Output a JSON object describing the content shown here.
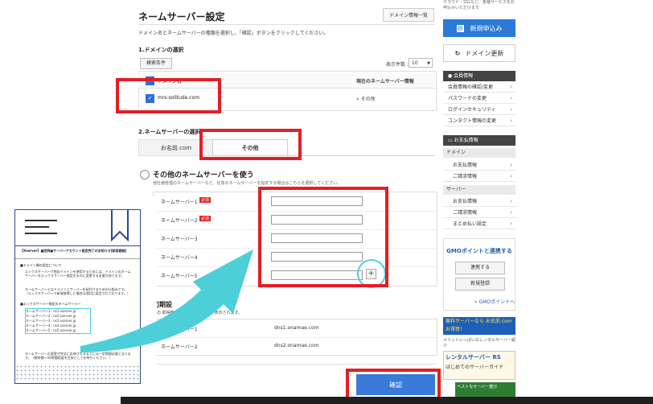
{
  "header": {
    "title": "ネームサーバー設定",
    "domain_list_button": "ドメイン情報一覧",
    "description": "ドメイン名とネームサーバーの種類を選択し、「確認」ボタンをクリックしてください。"
  },
  "step1": {
    "heading": "1.ドメインの選択",
    "search_button": "検索条件",
    "per_page_label": "表示件数 :",
    "per_page_value": "10",
    "col_domain": "ドメイン名",
    "col_ns": "現在のネームサーバー情報",
    "row_domain": "mrs-solitude.com",
    "row_ns": "» その他"
  },
  "step2": {
    "heading": "2.ネームサーバーの選択",
    "tab_onamae": "お名前.com",
    "tab_other": "その他",
    "other_option_title": "その他のネームサーバーを使う",
    "other_option_desc": "他社様管理のネームサーバーなど、任意のネームサーバーを指定する場合はこちらを選択してください。",
    "required_badge": "必須",
    "ns_labels": [
      "ネームサーバー1",
      "ネームサーバー2",
      "ネームサーバー3",
      "ネームサーバー4",
      "ネームサーバー5"
    ],
    "plus_label": "+"
  },
  "initial": {
    "heading": "初期設",
    "desc": "この 取得時の初期設定のページが表示されます。",
    "rows": [
      {
        "label": "ネームサーバー1",
        "value": "dns1.onamae.com"
      },
      {
        "label": "ネームサーバー2",
        "value": "dns2.onamae.com"
      }
    ]
  },
  "confirm_button": "確認",
  "sidebar": {
    "top_note": "クラウド・SSLなど、各種サービスをお申込みいただけます",
    "apply_button": "新規申込み",
    "renew_button": "ドメイン更新",
    "member_head": "会員情報",
    "member_items": [
      "会員情報の確認/変更",
      "パスワードの変更",
      "ログインセキュリティ",
      "コンタクト情報の変更"
    ],
    "payment_head": "お支払情報",
    "domain_sub": "ドメイン",
    "domain_items": [
      "お支払情報",
      "ご請求情報"
    ],
    "server_sub": "サーバー",
    "server_items": [
      "お支払情報",
      "ご請求情報",
      "まとめ払い設定"
    ],
    "gmo_title": "GMOポイントと連携する",
    "gmo_link_button": "連携する",
    "gmo_register_button": "新規登録",
    "gmo_point_link": "» GMOポイントへ",
    "banner1_text": "無料サーバーなら お名前.comお得意！",
    "banner2_caption": "メリットいっぱいのレンタルサーバー紹介",
    "banner3_title": "レンタルサーバー RS",
    "banner3_sub": "はじめてのサーバーガイド",
    "banner4_text": "ベストなサーバー選び"
  },
  "document": {
    "heading": "【Xserver】■定例■サーバーアカウント設定完了のお知らせ[試用期間]",
    "section1": "■ドメイン側の設定について",
    "para1": "エックスサーバーで独自ドメインを使用するためには、ドメインのネームサーバーをエックスサーバー指定のものに変更する必要があります。",
    "para2": "ネームサーバーとはドメインとサーバーを紐付けるための仕組みです。（エックスサーバーで新規取得した場合は適切に設定されております。）",
    "section2": "■エックスサーバー指定のネームサーバー",
    "ns_lines": [
      "ネームサーバー1 : ns1.xserver.jp",
      "ネームサーバー2 : ns2.xserver.jp",
      "ネームサーバー3 : ns3.xserver.jp",
      "ネームサーバー4 : ns4.xserver.jp",
      "ネームサーバー5 : ns5.xserver.jp"
    ],
    "footer": "ネームサーバーの変更が完全に反映されるまでには一定期間必要となります。（数時間〜24時間程度を目安としてお待ちください。）"
  },
  "colors": {
    "accent_blue": "#3a7ad8",
    "highlight_red": "#e31e25",
    "arrow_cyan": "#4ccfd8"
  }
}
